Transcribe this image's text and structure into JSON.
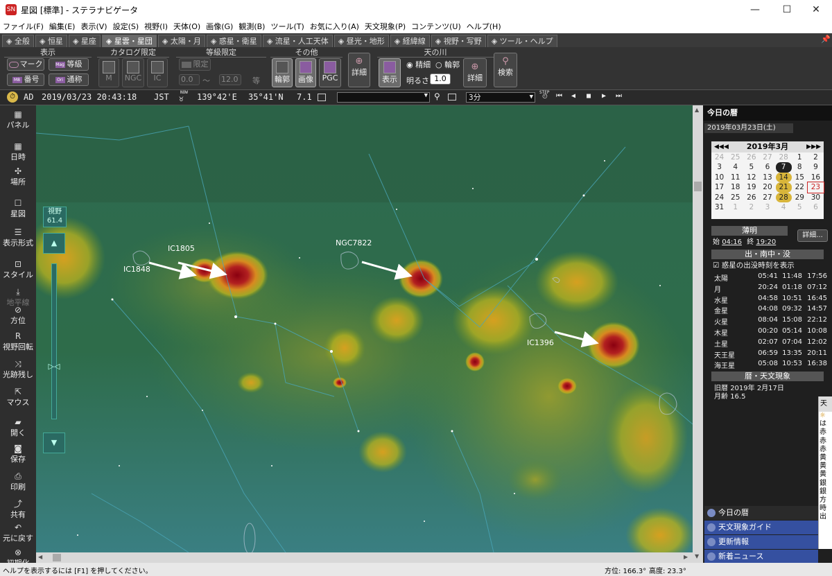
{
  "window": {
    "title": "星図 [標準] - ステラナビゲータ",
    "app_icon": "SN"
  },
  "menu": [
    "ファイル(F)",
    "編集(E)",
    "表示(V)",
    "設定(S)",
    "視野(I)",
    "天体(O)",
    "画像(G)",
    "観測(B)",
    "ツール(T)",
    "お気に入り(A)",
    "天文現象(P)",
    "コンテンツ(U)",
    "ヘルプ(H)"
  ],
  "tabs": [
    "全般",
    "恒星",
    "星座",
    "星雲・星団",
    "太陽・月",
    "惑星・衛星",
    "流星・人工天体",
    "昼光・地形",
    "経緯線",
    "視野・写野",
    "ツール・ヘルプ"
  ],
  "active_tab": 3,
  "ribbon": {
    "groups": {
      "hyoji": "表示",
      "catalog": "カタログ限定",
      "tokyu": "等級限定",
      "sonota": "その他",
      "amanogawa": "天の川"
    },
    "mark": "マーク",
    "bango": "番号",
    "tokyu_btn": "等級",
    "tsusho": "通称",
    "m": "M",
    "ngc": "NGC",
    "ic": "IC",
    "gentei": "限定",
    "mag_from": "0.0",
    "mag_sep": "〜",
    "mag_to": "12.0",
    "mag_unit": "等",
    "rinkaku": "輪郭",
    "gazo": "画像",
    "pgc": "PGC",
    "shosai": "詳細",
    "mw_hyoji": "表示",
    "seisai": "精細",
    "rinkaku2": "輪郭",
    "akarusa": "明るさ:",
    "akarusa_val": "1.0",
    "shosai2": "詳細",
    "kensaku": "検索"
  },
  "status": {
    "era": "AD",
    "datetime": "2019/03/23 20:43:18",
    "tz": "JST",
    "now_label": "NOW",
    "lon": "139°42'E",
    "lat": "35°41'N",
    "mag": "7.1",
    "step": "3分",
    "step_label": "STEP"
  },
  "leftbar": [
    {
      "label": "パネル",
      "icon": "panel-icon"
    },
    {
      "label": "日時",
      "icon": "datetime-icon"
    },
    {
      "label": "場所",
      "icon": "location-icon"
    },
    {
      "label": "星図",
      "icon": "chart-icon"
    },
    {
      "label": "表示形式",
      "icon": "display-format-icon"
    },
    {
      "label": "スタイル",
      "icon": "style-icon"
    },
    {
      "label": "地平線",
      "icon": "horizon-icon",
      "disabled": true
    },
    {
      "label": "方位",
      "icon": "direction-icon"
    },
    {
      "label": "視野回転",
      "icon": "rotate-icon"
    },
    {
      "label": "光跡残し",
      "icon": "trail-icon"
    },
    {
      "label": "マウス",
      "icon": "mouse-icon"
    },
    {
      "label": "開く",
      "icon": "open-icon"
    },
    {
      "label": "保存",
      "icon": "save-icon"
    },
    {
      "label": "印刷",
      "icon": "print-icon"
    },
    {
      "label": "共有",
      "icon": "share-icon"
    },
    {
      "label": "元に戻す",
      "icon": "undo-icon"
    },
    {
      "label": "初期化",
      "icon": "reset-icon"
    }
  ],
  "fov": {
    "label": "視野",
    "value": "61.4"
  },
  "sky_labels": {
    "ic1805": "IC1805",
    "ic1848": "IC1848",
    "ngc7822": "NGC7822",
    "ic1396": "IC1396"
  },
  "right": {
    "title": "今日の暦",
    "date": "2019年03月23日(土)",
    "cal_month": "2019年3月",
    "cal_days": [
      {
        "d": "24",
        "g": true
      },
      {
        "d": "25",
        "g": true
      },
      {
        "d": "26",
        "g": true
      },
      {
        "d": "27",
        "g": true
      },
      {
        "d": "28",
        "g": true
      },
      {
        "d": "1"
      },
      {
        "d": "2"
      },
      {
        "d": "3"
      },
      {
        "d": "4"
      },
      {
        "d": "5"
      },
      {
        "d": "6"
      },
      {
        "d": "7",
        "nm": true
      },
      {
        "d": "8"
      },
      {
        "d": "9"
      },
      {
        "d": "10"
      },
      {
        "d": "11"
      },
      {
        "d": "12"
      },
      {
        "d": "13"
      },
      {
        "d": "14",
        "mp": true
      },
      {
        "d": "15"
      },
      {
        "d": "16"
      },
      {
        "d": "17"
      },
      {
        "d": "18"
      },
      {
        "d": "19"
      },
      {
        "d": "20"
      },
      {
        "d": "21",
        "mp": true
      },
      {
        "d": "22"
      },
      {
        "d": "23",
        "today": true
      },
      {
        "d": "24"
      },
      {
        "d": "25"
      },
      {
        "d": "26"
      },
      {
        "d": "27"
      },
      {
        "d": "28",
        "mp": true
      },
      {
        "d": "29"
      },
      {
        "d": "30"
      },
      {
        "d": "31"
      },
      {
        "d": "1",
        "g": true
      },
      {
        "d": "2",
        "g": true
      },
      {
        "d": "3",
        "g": true
      },
      {
        "d": "4",
        "g": true
      },
      {
        "d": "5",
        "g": true
      },
      {
        "d": "6",
        "g": true
      }
    ],
    "hakumei": "薄明",
    "hakumei_start_label": "始",
    "hakumei_start": "04:16",
    "hakumei_end_label": "終",
    "hakumei_end": "19:20",
    "detail": "詳細...",
    "rise": "出・南中・没",
    "show_planets": "惑星の出没時刻を表示",
    "bodies": [
      [
        "太陽",
        "05:41",
        "11:48",
        "17:56"
      ],
      [
        "月",
        "20:24",
        "01:18",
        "07:12"
      ],
      [
        "水星",
        "04:58",
        "10:51",
        "16:45"
      ],
      [
        "金星",
        "04:08",
        "09:32",
        "14:57"
      ],
      [
        "火星",
        "08:04",
        "15:08",
        "22:12"
      ],
      [
        "木星",
        "00:20",
        "05:14",
        "10:08"
      ],
      [
        "土星",
        "02:07",
        "07:04",
        "12:02"
      ],
      [
        "天王星",
        "06:59",
        "13:35",
        "20:11"
      ],
      [
        "海王星",
        "05:08",
        "10:53",
        "16:38"
      ]
    ],
    "reki": "暦・天文現象",
    "kyureki_label": "旧暦",
    "kyureki": "2019年 2月17日",
    "getsurei_label": "月齢",
    "getsurei": "16.5",
    "links": [
      "今日の暦",
      "天文現象ガイド",
      "更新情報",
      "新着ニュース"
    ]
  },
  "bottom": {
    "help": "ヘルプを表示するには [F1] を押してください。",
    "azimuth": "方位: 166.3°",
    "altitude": "高度: 23.3°"
  }
}
